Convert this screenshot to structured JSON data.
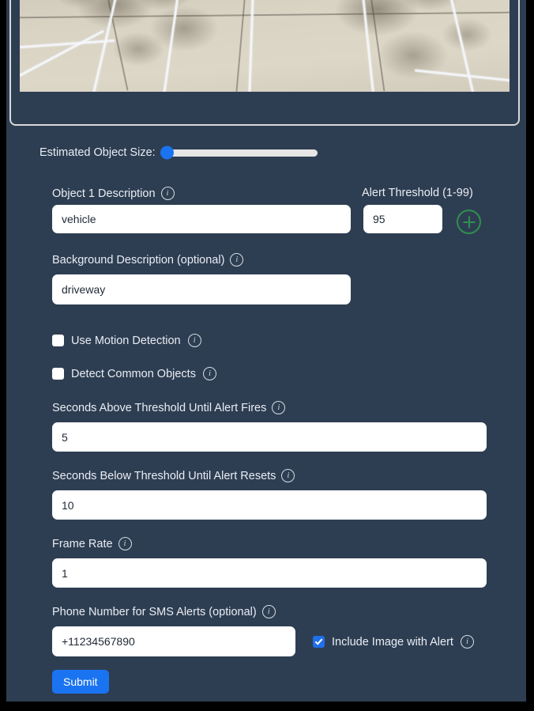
{
  "theme": {
    "page_border_color": "#000000",
    "surface_color": "#2e3e52",
    "label_color": "#e9edf4",
    "input_background": "#ffffff",
    "accent_blue": "#1a73f0",
    "checkbox_checked_color": "#1f6feb",
    "add_button_green": "#2f8f4e",
    "preview_border_color": "#d8d8d8"
  },
  "preview": {
    "name": "camera-preview",
    "scene_description": "driveway concrete slabs with white boundary lines, tree shadows, grass top right"
  },
  "slider": {
    "label": "Estimated Object Size:",
    "value_percent": 0,
    "min": 0,
    "max": 100
  },
  "fields": {
    "object1": {
      "label": "Object 1 Description",
      "value": "vehicle",
      "placeholder": "",
      "info_icon": "info-icon"
    },
    "threshold": {
      "label": "Alert Threshold (1-99)",
      "value": "95",
      "placeholder": ""
    },
    "add_object": {
      "icon": "plus-icon",
      "aria_label": "Add object"
    },
    "background": {
      "label": "Background Description (optional)",
      "value": "driveway",
      "placeholder": "",
      "info_icon": "info-icon"
    },
    "seconds_above": {
      "label": "Seconds Above Threshold Until Alert Fires",
      "value": "5",
      "placeholder": "",
      "info_icon": "info-icon"
    },
    "seconds_below": {
      "label": "Seconds Below Threshold Until Alert Resets",
      "value": "10",
      "placeholder": "",
      "info_icon": "info-icon"
    },
    "frame_rate": {
      "label": "Frame Rate",
      "value": "1",
      "placeholder": "",
      "info_icon": "info-icon"
    },
    "phone": {
      "label": "Phone Number for SMS Alerts (optional)",
      "value": "+11234567890",
      "placeholder": "",
      "info_icon": "info-icon"
    }
  },
  "checkboxes": {
    "use_motion_detection": {
      "label": "Use Motion Detection",
      "checked": false
    },
    "detect_common_objects": {
      "label": "Detect Common Objects",
      "checked": false
    },
    "include_image_with_alert": {
      "label": "Include Image with Alert",
      "checked": true
    }
  },
  "actions": {
    "submit_label": "Submit"
  }
}
